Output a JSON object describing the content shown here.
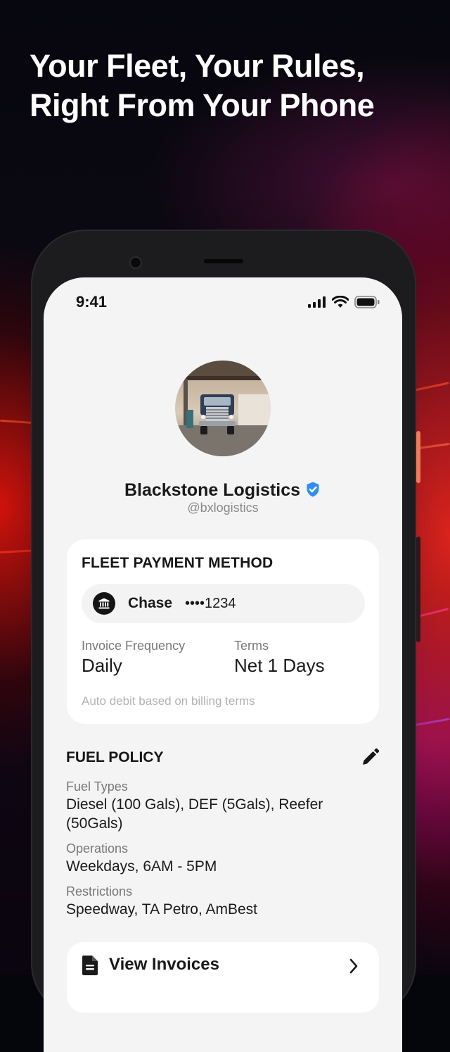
{
  "headline": {
    "line1": "Your Fleet, Your Rules,",
    "line2": "Right From Your Phone"
  },
  "status_bar": {
    "time": "9:41",
    "icons": [
      "signal-icon",
      "wifi-icon",
      "battery-icon"
    ]
  },
  "profile": {
    "name": "Blackstone Logistics",
    "handle": "@bxlogistics",
    "verified": true,
    "avatar_icon": "truck-photo"
  },
  "payment_card": {
    "title": "FLEET PAYMENT METHOD",
    "bank_name": "Chase",
    "account_mask": "••••1234",
    "invoice_frequency_label": "Invoice Frequency",
    "invoice_frequency_value": "Daily",
    "terms_label": "Terms",
    "terms_value": "Net 1 Days",
    "note": "Auto debit based on billing terms"
  },
  "fuel_policy": {
    "title": "FUEL POLICY",
    "fuel_types_label": "Fuel Types",
    "fuel_types_value": "Diesel (100 Gals), DEF (5Gals), Reefer (50Gals)",
    "operations_label": "Operations",
    "operations_value": "Weekdays, 6AM - 5PM",
    "restrictions_label": "Restrictions",
    "restrictions_value": "Speedway, TA Petro, AmBest"
  },
  "invoices": {
    "label": "View Invoices"
  },
  "colors": {
    "verified_badge": "#2f8ff0",
    "screen_bg": "#f4f4f4",
    "card_bg": "#ffffff",
    "accent_red": "#e8231b"
  }
}
